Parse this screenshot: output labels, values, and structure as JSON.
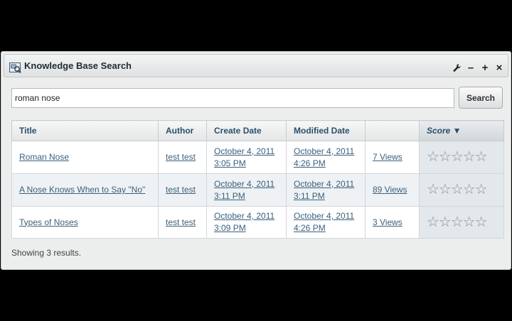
{
  "portlet": {
    "title": "Knowledge Base Search",
    "controls": {
      "config": "✎",
      "minimize": "–",
      "maximize": "+",
      "close": "×"
    }
  },
  "search": {
    "value": "roman nose",
    "button_label": "Search"
  },
  "table": {
    "headers": {
      "title": "Title",
      "author": "Author",
      "create_date": "Create Date",
      "modified_date": "Modified Date",
      "views": "",
      "score": "Score ▼"
    },
    "rows": [
      {
        "title": "Roman Nose",
        "author": "test test",
        "create_date_line1": "October 4, 2011",
        "create_date_line2": "3:05 PM",
        "modified_date_line1": "October 4, 2011",
        "modified_date_line2": "4:26 PM",
        "views": "7 Views",
        "score": "☆☆☆☆☆"
      },
      {
        "title": "A Nose Knows When to Say \"No\"",
        "author": "test test",
        "create_date_line1": "October 4, 2011",
        "create_date_line2": "3:11 PM",
        "modified_date_line1": "October 4, 2011",
        "modified_date_line2": "3:11 PM",
        "views": "89 Views",
        "score": "☆☆☆☆☆"
      },
      {
        "title": "Types of Noses",
        "author": "test test",
        "create_date_line1": "October 4, 2011",
        "create_date_line2": "3:09 PM",
        "modified_date_line1": "October 4, 2011",
        "modified_date_line2": "4:26 PM",
        "views": "3 Views",
        "score": "☆☆☆☆☆"
      }
    ]
  },
  "footer": {
    "showing_text": "Showing 3 results."
  }
}
